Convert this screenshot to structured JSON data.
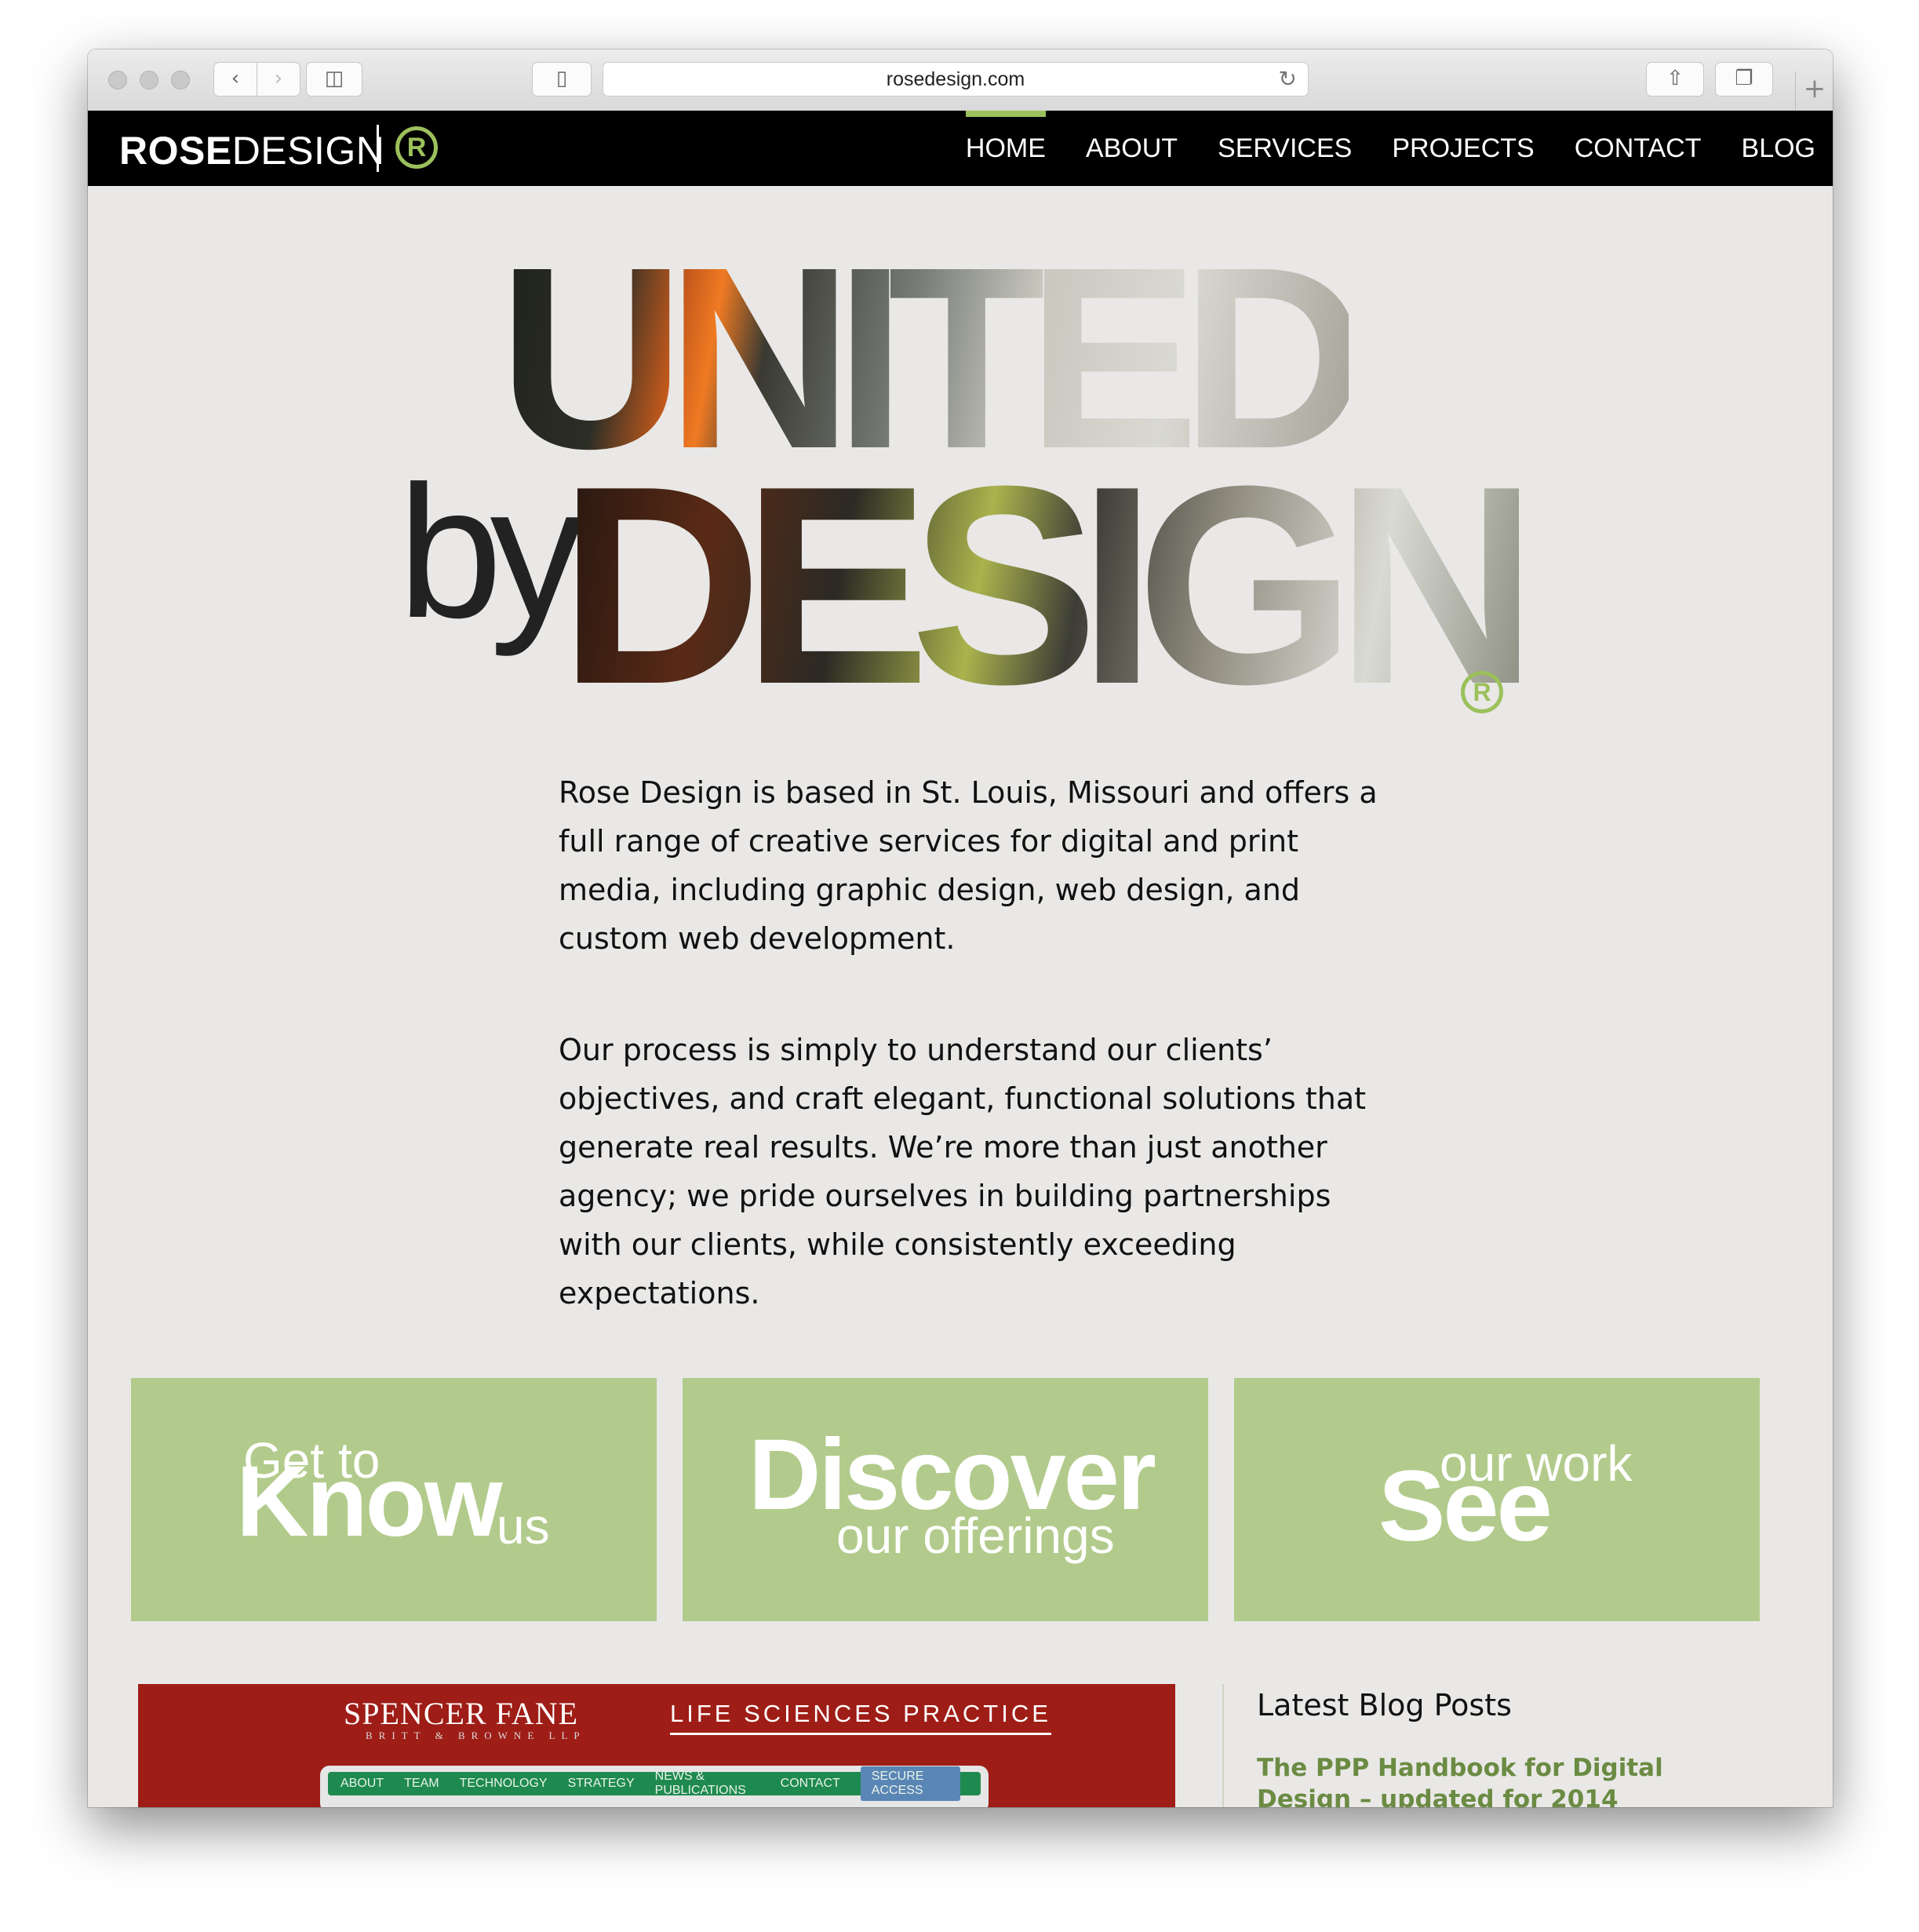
{
  "browser": {
    "url": "rosedesign.com",
    "icons": [
      "back-icon",
      "forward-icon",
      "sidebar-icon",
      "reader-icon",
      "reload-icon",
      "share-icon",
      "tabs-icon",
      "new-tab-icon"
    ]
  },
  "site": {
    "logo_bold": "ROSE",
    "logo_rest": "DESIGN",
    "logo_mark": "R",
    "nav": [
      "HOME",
      "ABOUT",
      "SERVICES",
      "PROJECTS",
      "CONTACT",
      "BLOG"
    ],
    "active_nav": "HOME",
    "accent": "#9bc05c"
  },
  "hero": {
    "line1": "UNITED",
    "by": "by",
    "line2": "DESIGN",
    "reg": "R"
  },
  "intro": {
    "p1": "Rose Design is based in St. Louis, Missouri and offers a full range of creative services for digital and print media, including graphic design, web design, and custom web development.",
    "p2": "Our process is simply to understand our clients’ objectives, and craft elegant, functional solutions that generate real results. We’re more than just another agency; we pride ourselves in building partnerships with our clients, while consistently exceeding expectations."
  },
  "tiles": [
    {
      "small_top": "Get to",
      "big": "Know",
      "small_bottom": "us"
    },
    {
      "big": "Discover",
      "small_bottom": "our offerings"
    },
    {
      "small_top": "our work",
      "big": "See"
    }
  ],
  "tile_color": "#b2cb8c",
  "showcase": {
    "title": "SPENCER FANE",
    "subtitle": "BRITT & BROWNE LLP",
    "practice": "LIFE SCIENCES PRACTICE",
    "nav": [
      "ABOUT",
      "TEAM",
      "TECHNOLOGY",
      "STRATEGY",
      "NEWS & PUBLICATIONS",
      "CONTACT"
    ],
    "secure": "SECURE ACCESS"
  },
  "blog": {
    "heading": "Latest Blog Posts",
    "post_title": "The PPP Handbook for Digital Design – updated for 2014"
  }
}
